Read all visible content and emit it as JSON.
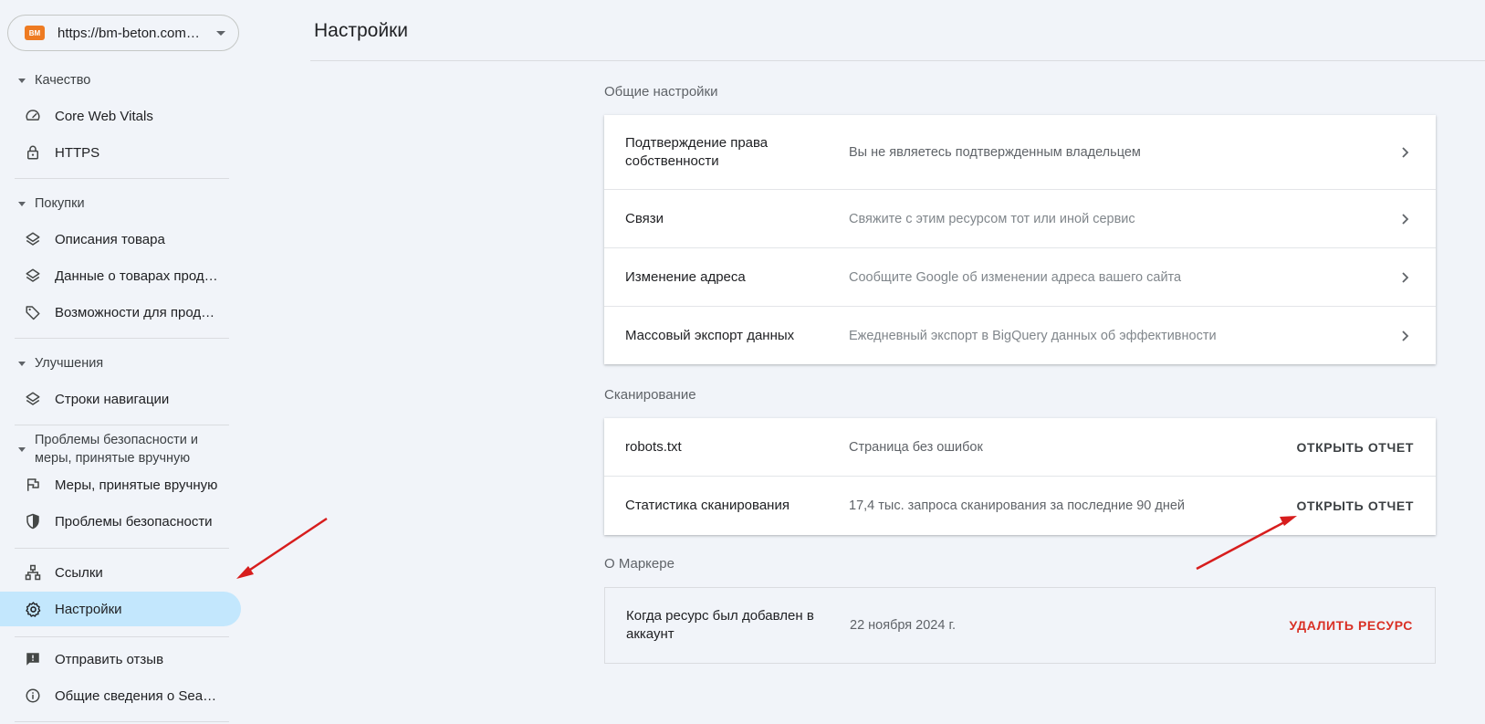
{
  "property": {
    "logo_text": "BM",
    "url": "https://bm-beton.com.ua/"
  },
  "sidebar": {
    "sections": [
      {
        "label": "Качество"
      },
      {
        "label": "Покупки"
      },
      {
        "label": "Улучшения"
      },
      {
        "label": "Проблемы безопасности и меры, принятые вручную"
      }
    ],
    "items": {
      "cwv": "Core Web Vitals",
      "https": "HTTPS",
      "product_snippets": "Описания товара",
      "merchant_listings": "Данные о товарах продавцов",
      "shopping_tab": "Возможности для продавцов",
      "breadcrumbs": "Строки навигации",
      "manual_actions": "Меры, принятые вручную",
      "security_issues": "Проблемы безопасности",
      "links": "Ссылки",
      "settings": "Настройки",
      "feedback": "Отправить отзыв",
      "about": "Общие сведения о Search Console"
    }
  },
  "page": {
    "title": "Настройки"
  },
  "general": {
    "label": "Общие настройки",
    "rows": [
      {
        "title": "Подтверждение права собственности",
        "desc": "Вы не являетесь подтвержденным владельцем"
      },
      {
        "title": "Связи",
        "desc": "Свяжите с этим ресурсом тот или иной сервис"
      },
      {
        "title": "Изменение адреса",
        "desc": "Сообщите Google об изменении адреса вашего сайта"
      },
      {
        "title": "Массовый экспорт данных",
        "desc": "Ежедневный экспорт в BigQuery данных об эффективности"
      }
    ]
  },
  "crawling": {
    "label": "Сканирование",
    "rows": [
      {
        "title": "robots.txt",
        "desc": "Страница без ошибок",
        "action": "ОТКРЫТЬ ОТЧЕТ"
      },
      {
        "title": "Статистика сканирования",
        "desc": "17,4 тыс. запроса сканирования за последние 90 дней",
        "action": "ОТКРЫТЬ ОТЧЕТ"
      }
    ]
  },
  "about": {
    "label": "О Маркере",
    "row": {
      "title": "Когда ресурс был добавлен в аккаунт",
      "desc": "22 ноября 2024 г.",
      "action": "УДАЛИТЬ РЕСУРС"
    }
  },
  "colors": {
    "accent_active": "#c3e7fd",
    "danger": "#d93025",
    "annotation_arrow": "#d71d1d"
  }
}
